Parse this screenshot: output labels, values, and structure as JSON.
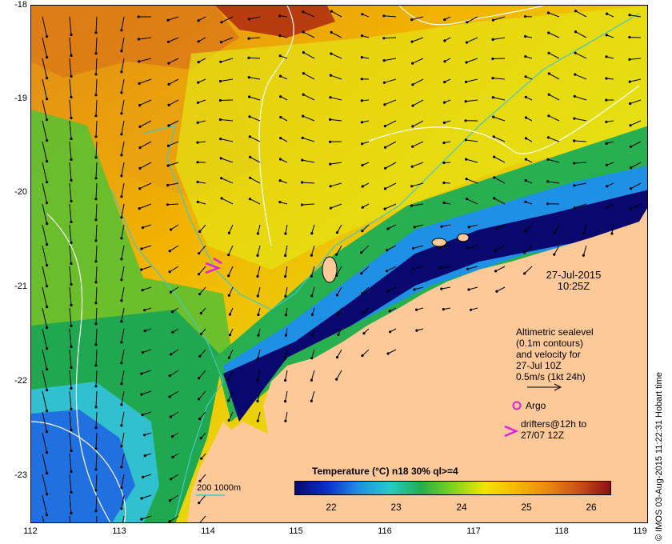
{
  "axes": {
    "y_ticks": [
      "-18",
      "-19",
      "-20",
      "-21",
      "-22",
      "-23"
    ],
    "x_ticks": [
      "112",
      "113",
      "114",
      "115",
      "116",
      "117",
      "118",
      "119"
    ]
  },
  "map": {
    "date": "27-Jul-2015",
    "time": "10:25Z",
    "notes": [
      "Altimetric sealevel",
      "(0.1m contours)",
      "and velocity for",
      "27-Jul 10Z",
      "0.5m/s (1kt 24h)"
    ],
    "argo_label": "Argo",
    "drifters_line1": "drifters@12h to",
    "drifters_line2": "27/07 12Z",
    "contour_key": "200  1000m"
  },
  "legend": {
    "title": "Temperature (°C) n18 30% ql>=4",
    "ticks": [
      "22",
      "23",
      "24",
      "25",
      "26"
    ],
    "colors": [
      "#08086e",
      "#0a2fc8",
      "#1e90e6",
      "#27c8c8",
      "#22b04a",
      "#7ed321",
      "#f2e400",
      "#f5b800",
      "#e88a10",
      "#c8501a",
      "#8a1010"
    ]
  },
  "credit": "© IMOS 03-Aug-2015 11:22:31  Hobart time",
  "colors": {
    "land": "#fdc999",
    "arrow": "#000000",
    "contour": "#ffffff",
    "isobath": "#40c8c8",
    "argo": "#e020e0"
  }
}
